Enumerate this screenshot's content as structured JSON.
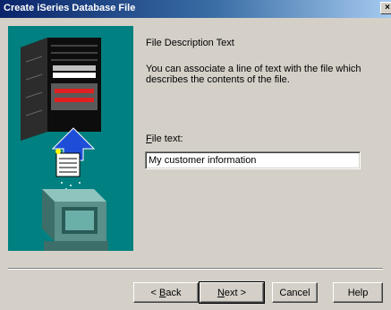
{
  "window": {
    "title": "Create iSeries Database File",
    "close_glyph": "×"
  },
  "content": {
    "heading": "File Description Text",
    "description": "You can associate a line of text with the file which describes the contents of the file.",
    "field_label_underlined": "F",
    "field_label_rest": "ile text:",
    "field_value": "My customer information"
  },
  "buttons": {
    "back_prefix": "< ",
    "back_underlined": "B",
    "back_rest": "ack",
    "next_underlined": "N",
    "next_rest": "ext >",
    "cancel": "Cancel",
    "help": "Help"
  },
  "colors": {
    "title_bar": "#0a246a",
    "art_background": "#008080",
    "dialog_background": "#d4d0c8"
  },
  "icons": {
    "illustration": "server-upload-illustration"
  }
}
